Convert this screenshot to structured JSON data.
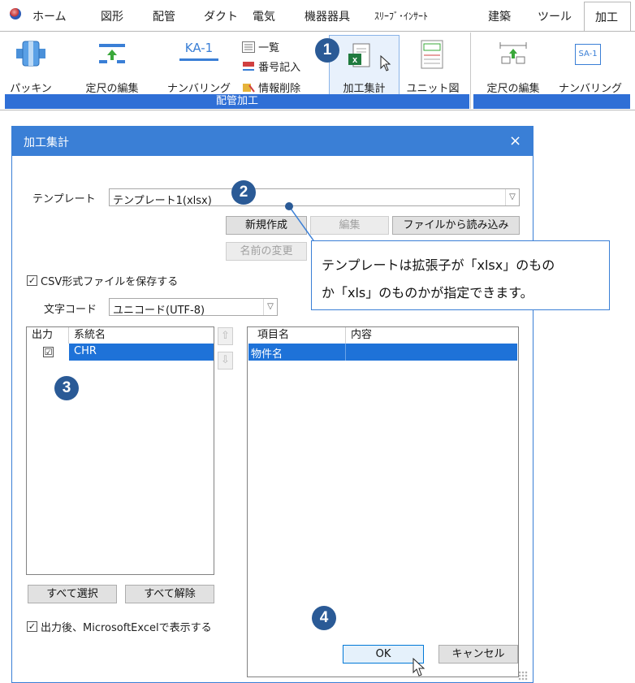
{
  "ribbon": {
    "menu_items": [
      "ホーム",
      "図形",
      "配管",
      "ダクト",
      "電気",
      "機器器具",
      "ｽﾘｰﾌﾞ･ｲﾝｻｰﾄ",
      "建築",
      "ツール"
    ],
    "active_tab": "加工",
    "buttons": {
      "packing": "パッキン",
      "ruler_edit": "定尺の編集",
      "numbering": "ナンバリング",
      "list": "一覧",
      "number_entry": "番号記入",
      "info_delete": "情報削除",
      "process_summary": "加工集計",
      "unit_diagram": "ユニット図",
      "ruler_edit_2": "定尺の編集",
      "numbering_2": "ナンバリング"
    },
    "icon_text": {
      "ka1": "KA-1",
      "sa1": "SA-1"
    },
    "group_label": "配管加工",
    "accent": "#2f6fd6"
  },
  "dialog": {
    "title": "加工集計",
    "close": "×",
    "template_label": "テンプレート",
    "template_value": "テンプレート1(xlsx)",
    "btn_new": "新規作成",
    "btn_edit": "編集",
    "btn_load": "ファイルから読み込み",
    "btn_rename": "名前の変更",
    "csv_check_label": "CSV形式ファイルを保存する",
    "csv_checked": true,
    "charcode_label": "文字コード",
    "charcode_value": "ユニコード(UTF-8)",
    "left_list": {
      "headers": [
        "出力",
        "系統名"
      ],
      "rows": [
        {
          "output": "☑",
          "name": "CHR"
        }
      ]
    },
    "right_list": {
      "headers": [
        "項目名",
        "内容"
      ],
      "rows": [
        {
          "item": "物件名",
          "content": ""
        }
      ]
    },
    "btn_select_all": "すべて選択",
    "btn_deselect_all": "すべて解除",
    "excel_check_label": "出力後、MicrosoftExcelで表示する",
    "excel_checked": true,
    "btn_ok": "OK",
    "btn_cancel": "キャンセル",
    "titlebar_color": "#3a7fd6",
    "selection_color": "#1e72d8"
  },
  "callout": {
    "line1": "テンプレートは拡張子が「xlsx」のもの",
    "line2": "か「xls」のものかが指定できます。"
  },
  "badges": [
    "1",
    "2",
    "3",
    "4"
  ],
  "badge_color": "#2a5a96"
}
